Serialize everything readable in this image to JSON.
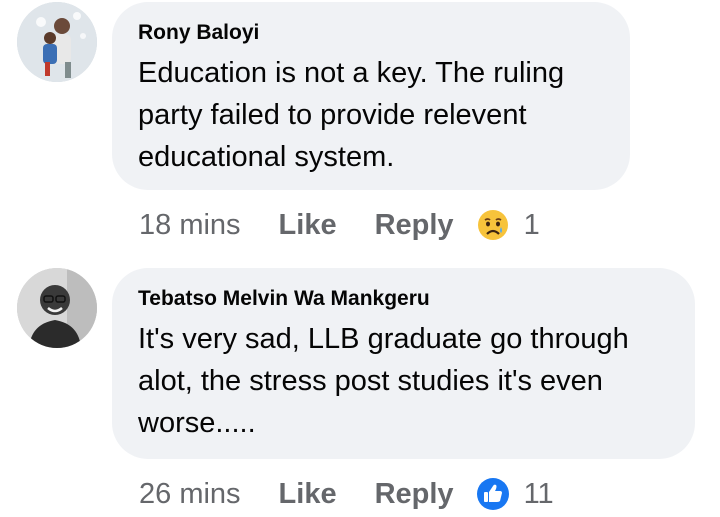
{
  "comments": [
    {
      "author": "Rony Baloyi",
      "text": "Education is not a key. The ruling party failed to provide relevent educational system.",
      "time": "18 mins",
      "like_label": "Like",
      "reply_label": "Reply",
      "reaction_icon": "sad-face-icon",
      "reaction_count": "1"
    },
    {
      "author": "Tebatso Melvin Wa Mankgeru",
      "text": "It's very sad, LLB graduate go through alot, the stress post studies it's even worse.....",
      "time": "26 mins",
      "like_label": "Like",
      "reply_label": "Reply",
      "reaction_icon": "thumbs-up-icon",
      "reaction_count": "11"
    }
  ],
  "colors": {
    "bubble_bg": "#f0f2f5",
    "meta_text": "#65676b",
    "like_blue": "#1877f2",
    "sad_yellow": "#f7c33b"
  }
}
